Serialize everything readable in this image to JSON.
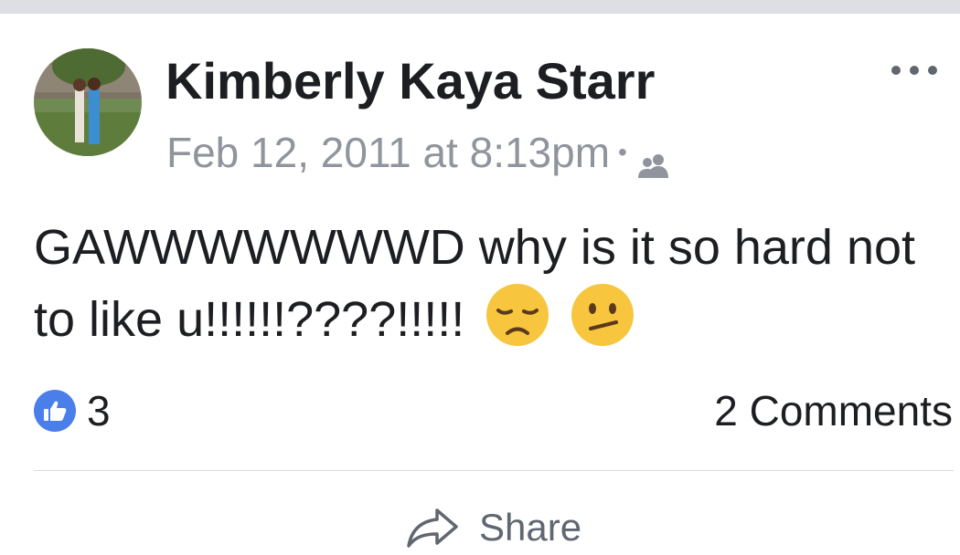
{
  "post": {
    "author": "Kimberly Kaya Starr",
    "timestamp": "Feb 12, 2011 at 8:13pm",
    "separator": "•",
    "audience_icon": "friends-icon",
    "text": "GAWWWWWWWD why is it so hard not to like u!!!!!!????!!!!!",
    "emojis": [
      "disappointed-face",
      "confused-face"
    ],
    "more_icon": "more-options-icon"
  },
  "reactions": {
    "icon": "like-icon",
    "count": "3",
    "comments_label": "2 Comments"
  },
  "actions": {
    "share_label": "Share",
    "share_icon": "share-arrow-icon"
  },
  "colors": {
    "like_blue": "#4a7ee8",
    "secondary_text": "#90949c",
    "primary_text": "#1c1e21"
  }
}
